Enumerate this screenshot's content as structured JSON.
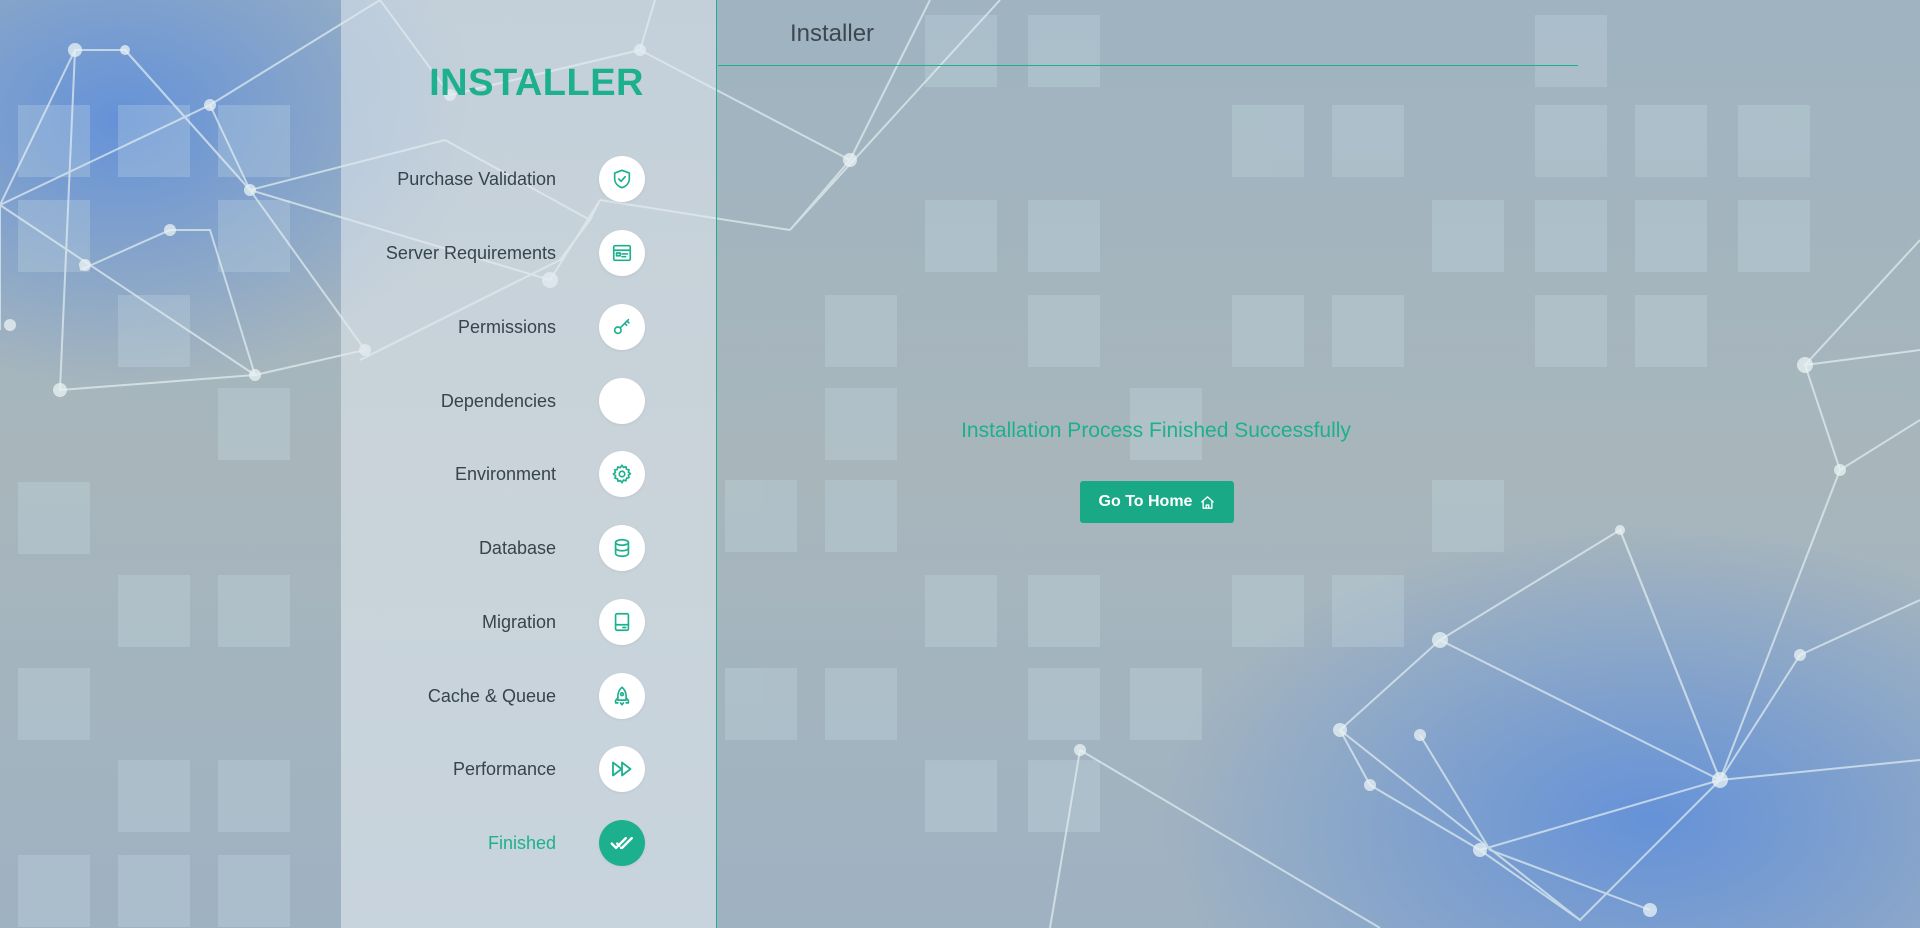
{
  "header": {
    "title": "Installer"
  },
  "sidebar": {
    "brand": "INSTALLER",
    "steps": [
      {
        "label": "Purchase Validation",
        "icon": "shield-check-icon"
      },
      {
        "label": "Server Requirements",
        "icon": "server-window-icon"
      },
      {
        "label": "Permissions",
        "icon": "key-icon"
      },
      {
        "label": "Dependencies",
        "icon": ""
      },
      {
        "label": "Environment",
        "icon": "gear-icon"
      },
      {
        "label": "Database",
        "icon": "database-icon"
      },
      {
        "label": "Migration",
        "icon": "drive-icon"
      },
      {
        "label": "Cache & Queue",
        "icon": "rocket-icon"
      },
      {
        "label": "Performance",
        "icon": "fast-forward-icon"
      },
      {
        "label": "Finished",
        "icon": "double-check-icon",
        "active": true
      }
    ]
  },
  "main": {
    "message": "Installation Process Finished Successfully",
    "home_button": {
      "label": "Go To Home",
      "icon": "home-icon"
    }
  },
  "colors": {
    "accent": "#1db08e",
    "button": "#1aa987",
    "text": "#36444d"
  }
}
